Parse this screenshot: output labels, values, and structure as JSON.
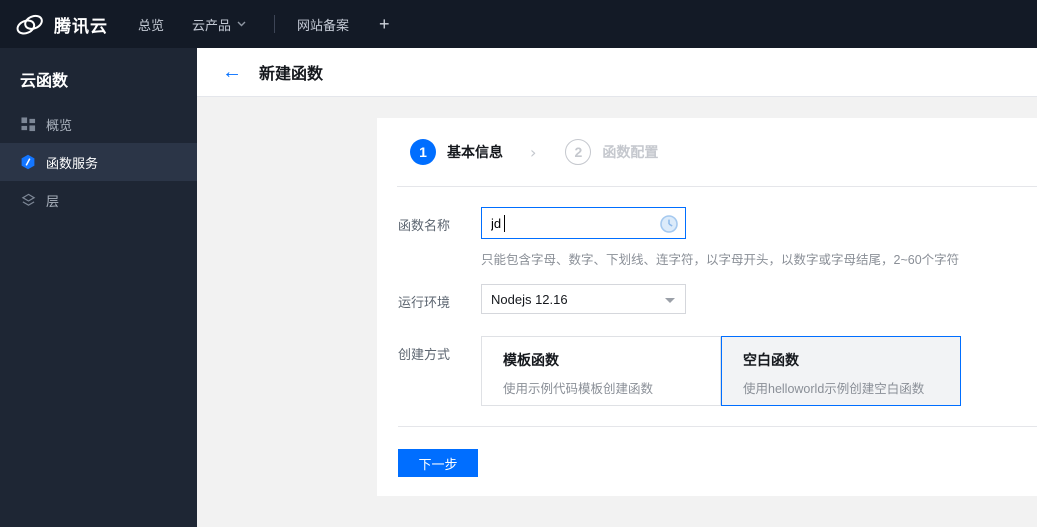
{
  "topnav": {
    "brand": "腾讯云",
    "overview": "总览",
    "products": "云产品",
    "beian": "网站备案",
    "plus": "+"
  },
  "sidebar": {
    "title": "云函数",
    "items": [
      {
        "label": "概览",
        "icon": "grid-overview-icon"
      },
      {
        "label": "函数服务",
        "icon": "function-hexagon-icon"
      },
      {
        "label": "层",
        "icon": "layers-icon"
      }
    ]
  },
  "header": {
    "back_icon": "←",
    "title": "新建函数"
  },
  "wizard": {
    "step1_num": "1",
    "step1_label": "基本信息",
    "separator": "›",
    "step2_num": "2",
    "step2_label": "函数配置"
  },
  "form": {
    "name_label": "函数名称",
    "name_value": "jd",
    "name_hint": "只能包含字母、数字、下划线、连字符，以字母开头，以数字或字母结尾，2~60个字符",
    "runtime_label": "运行环境",
    "runtime_value": "Nodejs 12.16",
    "method_label": "创建方式",
    "method_template_title": "模板函数",
    "method_template_desc": "使用示例代码模板创建函数",
    "method_blank_title": "空白函数",
    "method_blank_desc": "使用helloworld示例创建空白函数",
    "next_button": "下一步"
  },
  "colors": {
    "accent_blue": "#006eff",
    "topnav_bg": "#131a26",
    "sidebar_bg": "#1e2634",
    "sidebar_selected_bg": "#2b3547",
    "content_bg": "#f2f2f2",
    "inactive_step": "#c5c8ce"
  }
}
